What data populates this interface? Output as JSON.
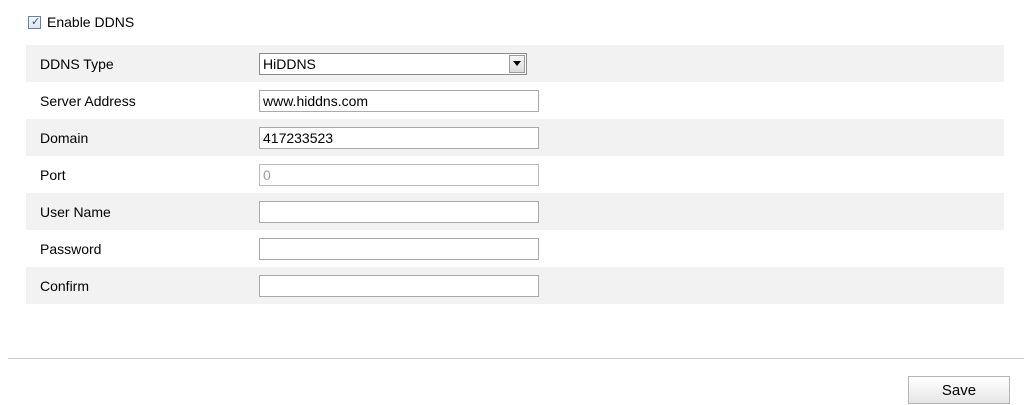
{
  "enable": {
    "label": "Enable DDNS",
    "checked": true,
    "check_glyph": "✓"
  },
  "form": {
    "ddns_type": {
      "label": "DDNS Type",
      "value": "HiDDNS",
      "icon": "chevron-down-icon"
    },
    "server_address": {
      "label": "Server Address",
      "value": "www.hiddns.com"
    },
    "domain": {
      "label": "Domain",
      "value": "417233523"
    },
    "port": {
      "label": "Port",
      "value": "0",
      "disabled": true
    },
    "user_name": {
      "label": "User Name",
      "value": ""
    },
    "password": {
      "label": "Password",
      "value": ""
    },
    "confirm": {
      "label": "Confirm",
      "value": ""
    }
  },
  "actions": {
    "save_label": "Save"
  },
  "colors": {
    "row_shade": "#f2f2f2",
    "field_border": "#aaaaaa",
    "disabled_text": "#a0a0a0",
    "divider": "#cccccc"
  }
}
